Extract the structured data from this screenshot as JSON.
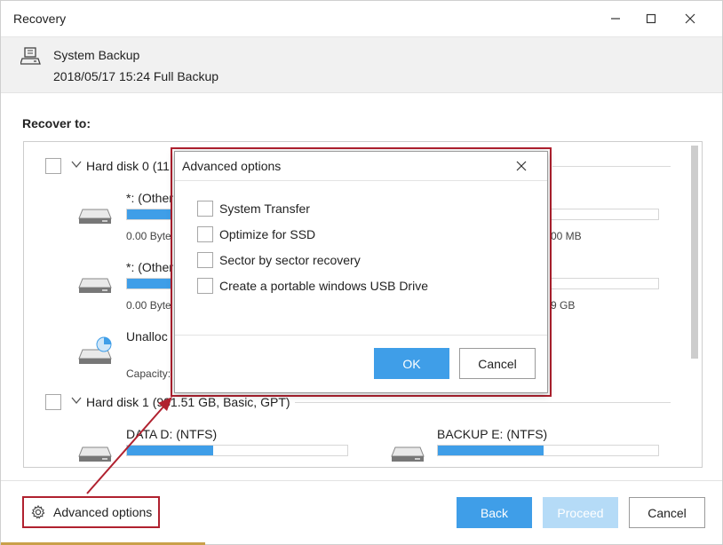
{
  "window": {
    "title": "Recovery"
  },
  "header": {
    "name": "System Backup",
    "info": "2018/05/17 15:24 Full Backup"
  },
  "recover_to_label": "Recover to:",
  "disks": [
    {
      "label": "Hard disk 0 (11",
      "partitions": [
        {
          "name": "*: (Other",
          "size_left": "0.00 Byte",
          "size_right": "00 MB",
          "fill_pct": 100
        },
        {
          "name": "*: (Other",
          "size_left": "0.00 Byte",
          "size_right": "9 GB",
          "fill_pct": 100
        },
        {
          "name": "Unalloc",
          "capacity": "Capacity:"
        }
      ]
    },
    {
      "label": "Hard disk 1 (931.51 GB, Basic, GPT)",
      "partitions": [
        {
          "name": "DATA D: (NTFS)",
          "fill_pct": 39
        },
        {
          "name": "BACKUP E: (NTFS)",
          "fill_pct": 48
        }
      ]
    }
  ],
  "footer": {
    "advanced_options": "Advanced options",
    "back": "Back",
    "proceed": "Proceed",
    "cancel": "Cancel"
  },
  "modal": {
    "title": "Advanced options",
    "options": [
      "System Transfer",
      "Optimize for SSD",
      "Sector by sector recovery",
      "Create a portable windows USB Drive"
    ],
    "ok": "OK",
    "cancel": "Cancel"
  },
  "colors": {
    "accent": "#3f9ee8",
    "accent_disabled": "#b5dbf7",
    "highlight": "#b0212f"
  }
}
